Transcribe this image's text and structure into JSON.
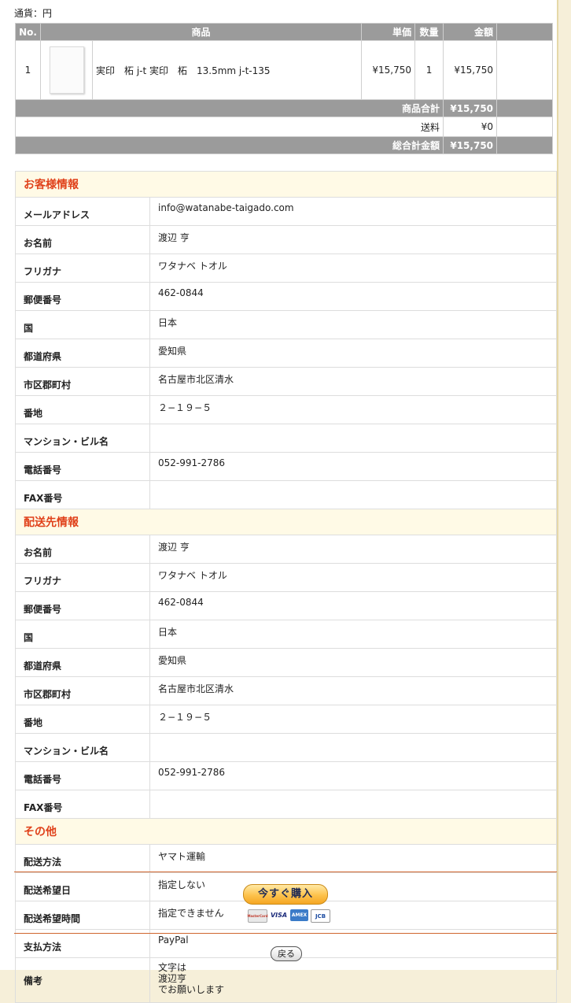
{
  "currency_label": "通貨：円",
  "order": {
    "headers": {
      "no": "No.",
      "product": "商品",
      "unit_price": "単価",
      "qty": "数量",
      "amount": "金額"
    },
    "items": [
      {
        "no": "1",
        "name": "実印　柘 j-t 実印　柘　13.5mm j-t-135",
        "unit_price": "¥15,750",
        "qty": "1",
        "amount": "¥15,750"
      }
    ],
    "subtotal_label": "商品合計",
    "subtotal": "¥15,750",
    "shipping_label": "送料",
    "shipping": "¥0",
    "total_label": "総合計金額",
    "total": "¥15,750"
  },
  "customer": {
    "title": "お客様情報",
    "fields": [
      {
        "label": "メールアドレス",
        "value": "info@watanabe-taigado.com"
      },
      {
        "label": "お名前",
        "value": "渡辺 亨"
      },
      {
        "label": "フリガナ",
        "value": "ワタナベ トオル"
      },
      {
        "label": "郵便番号",
        "value": "462-0844"
      },
      {
        "label": "国",
        "value": "日本"
      },
      {
        "label": "都道府県",
        "value": "愛知県"
      },
      {
        "label": "市区郡町村",
        "value": "名古屋市北区清水"
      },
      {
        "label": "番地",
        "value": "２−１９−５"
      },
      {
        "label": "マンション・ビル名",
        "value": ""
      },
      {
        "label": "電話番号",
        "value": "052-991-2786"
      },
      {
        "label": "FAX番号",
        "value": ""
      }
    ]
  },
  "shipping_info": {
    "title": "配送先情報",
    "fields": [
      {
        "label": "お名前",
        "value": "渡辺 亨"
      },
      {
        "label": "フリガナ",
        "value": "ワタナベ トオル"
      },
      {
        "label": "郵便番号",
        "value": "462-0844"
      },
      {
        "label": "国",
        "value": "日本"
      },
      {
        "label": "都道府県",
        "value": "愛知県"
      },
      {
        "label": "市区郡町村",
        "value": "名古屋市北区清水"
      },
      {
        "label": "番地",
        "value": "２−１９−５"
      },
      {
        "label": "マンション・ビル名",
        "value": ""
      },
      {
        "label": "電話番号",
        "value": "052-991-2786"
      },
      {
        "label": "FAX番号",
        "value": ""
      }
    ]
  },
  "other": {
    "title": "その他",
    "fields": [
      {
        "label": "配送方法",
        "value": "ヤマト運輸"
      },
      {
        "label": "配送希望日",
        "value": "指定しない"
      },
      {
        "label": "配送希望時間",
        "value": "指定できません"
      },
      {
        "label": "支払方法",
        "value": "PayPal"
      }
    ],
    "memo_label": "備考",
    "memo_lines": [
      "文字は",
      "渡辺亨",
      "でお願いします"
    ]
  },
  "buttons": {
    "buy_now": "今すぐ購入",
    "back": "戻る"
  },
  "payment_cards": {
    "mastercard": "MasterCard",
    "visa": "VISA",
    "amex": "AMEX",
    "jcb": "JCB"
  }
}
